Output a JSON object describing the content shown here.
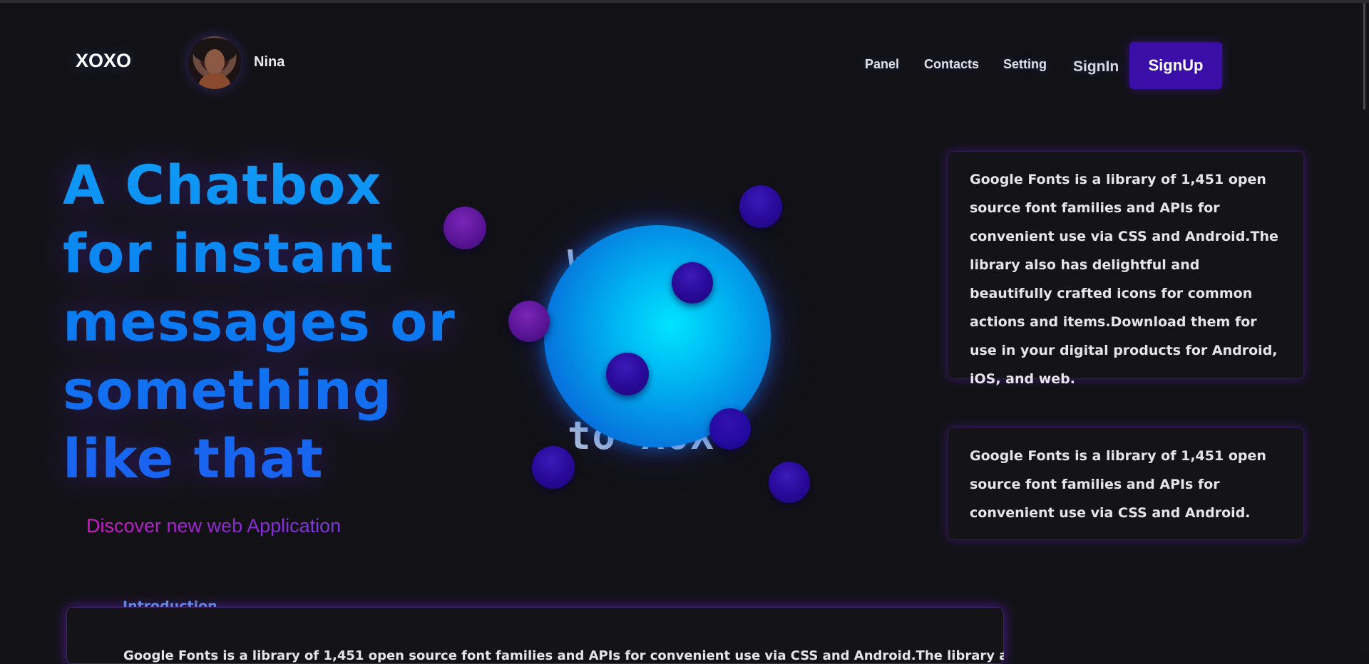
{
  "header": {
    "logo": "XOXO",
    "user_name": "Nina",
    "nav": [
      "Panel",
      "Contacts",
      "Setting"
    ],
    "signin_label": "SignIn",
    "signup_label": "SignUp"
  },
  "hero": {
    "headline": "A Chatbox for instant messages or something like that",
    "subtitle": "Discover new web Application"
  },
  "center": {
    "welcome_line1": "Welcome",
    "welcome_line2": "to XOX"
  },
  "cards": [
    {
      "text": "Google Fonts is a library of 1,451 open source font families and APIs for convenient use via CSS and Android.The library also has delightful and beautifully crafted icons for common actions and items.Download them for use in your digital products for Android, iOS, and web."
    },
    {
      "text": "Google Fonts is a library of 1,451 open source font families and APIs for convenient use via CSS and Android."
    }
  ],
  "introduction": {
    "label": "Introduction",
    "partial_text": "Google Fonts is a library of 1,451 open source font families and APIs for convenient use via CSS and Android.The library also has"
  },
  "colors": {
    "background": "#121216",
    "signup_button": "#3b0ea8",
    "headline_gradient_top": "#109cf5",
    "headline_gradient_bottom": "#1c5ff0",
    "subtitle_gradient_start": "#d218c8",
    "card_glow": "#5f1ebe",
    "sphere": "#00b7f3"
  }
}
